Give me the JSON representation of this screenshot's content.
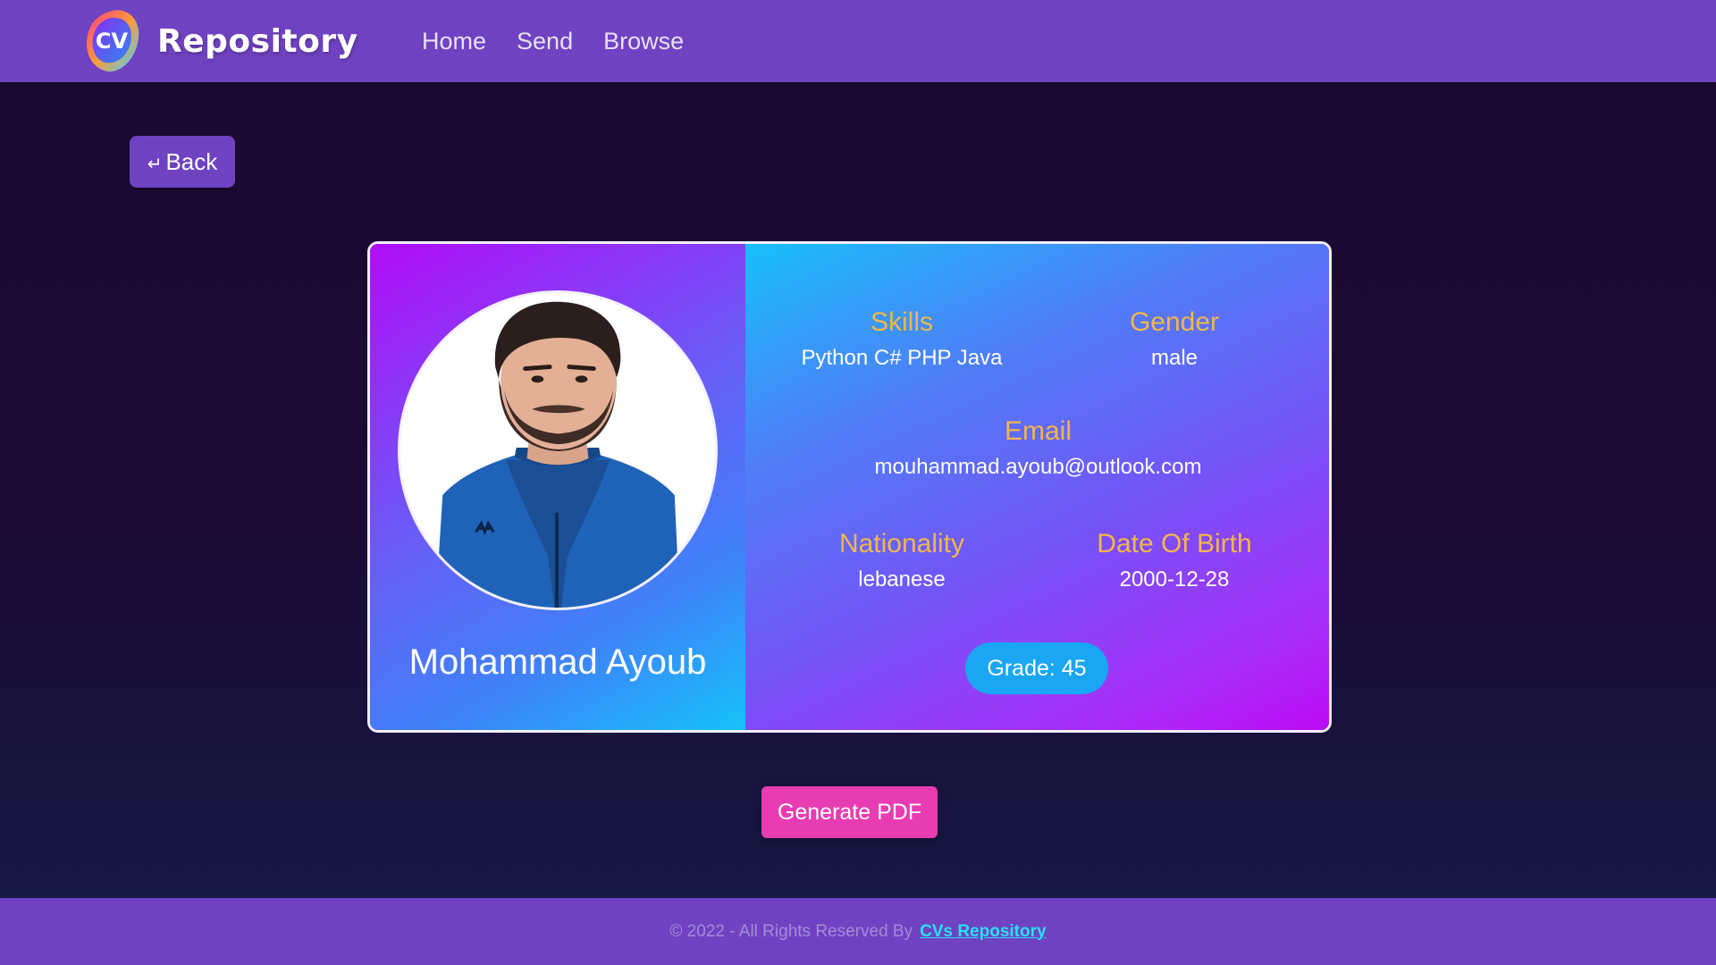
{
  "navbar": {
    "brand": "Repository",
    "logo_text": "CV",
    "links": [
      "Home",
      "Send",
      "Browse"
    ]
  },
  "back_button": {
    "icon": "return-arrow-icon",
    "label": "Back"
  },
  "profile": {
    "name": "Mohammad Ayoub",
    "skills_label": "Skills",
    "skills": "Python C# PHP Java",
    "gender_label": "Gender",
    "gender": "male",
    "email_label": "Email",
    "email": "mouhammad.ayoub@outlook.com",
    "nationality_label": "Nationality",
    "nationality": "lebanese",
    "dob_label": "Date Of Birth",
    "dob": "2000-12-28",
    "grade": "Grade: 45"
  },
  "pdf_button": "Generate PDF",
  "footer": {
    "text": "© 2022 - All Rights Reserved By",
    "link": "CVs Repository"
  },
  "colors": {
    "primary": "#6f42c1",
    "label_gold": "#f2b64a",
    "pdf_pink": "#e83cb2",
    "grade_blue": "#1aa6f2",
    "footer_link": "#29e0ef"
  }
}
